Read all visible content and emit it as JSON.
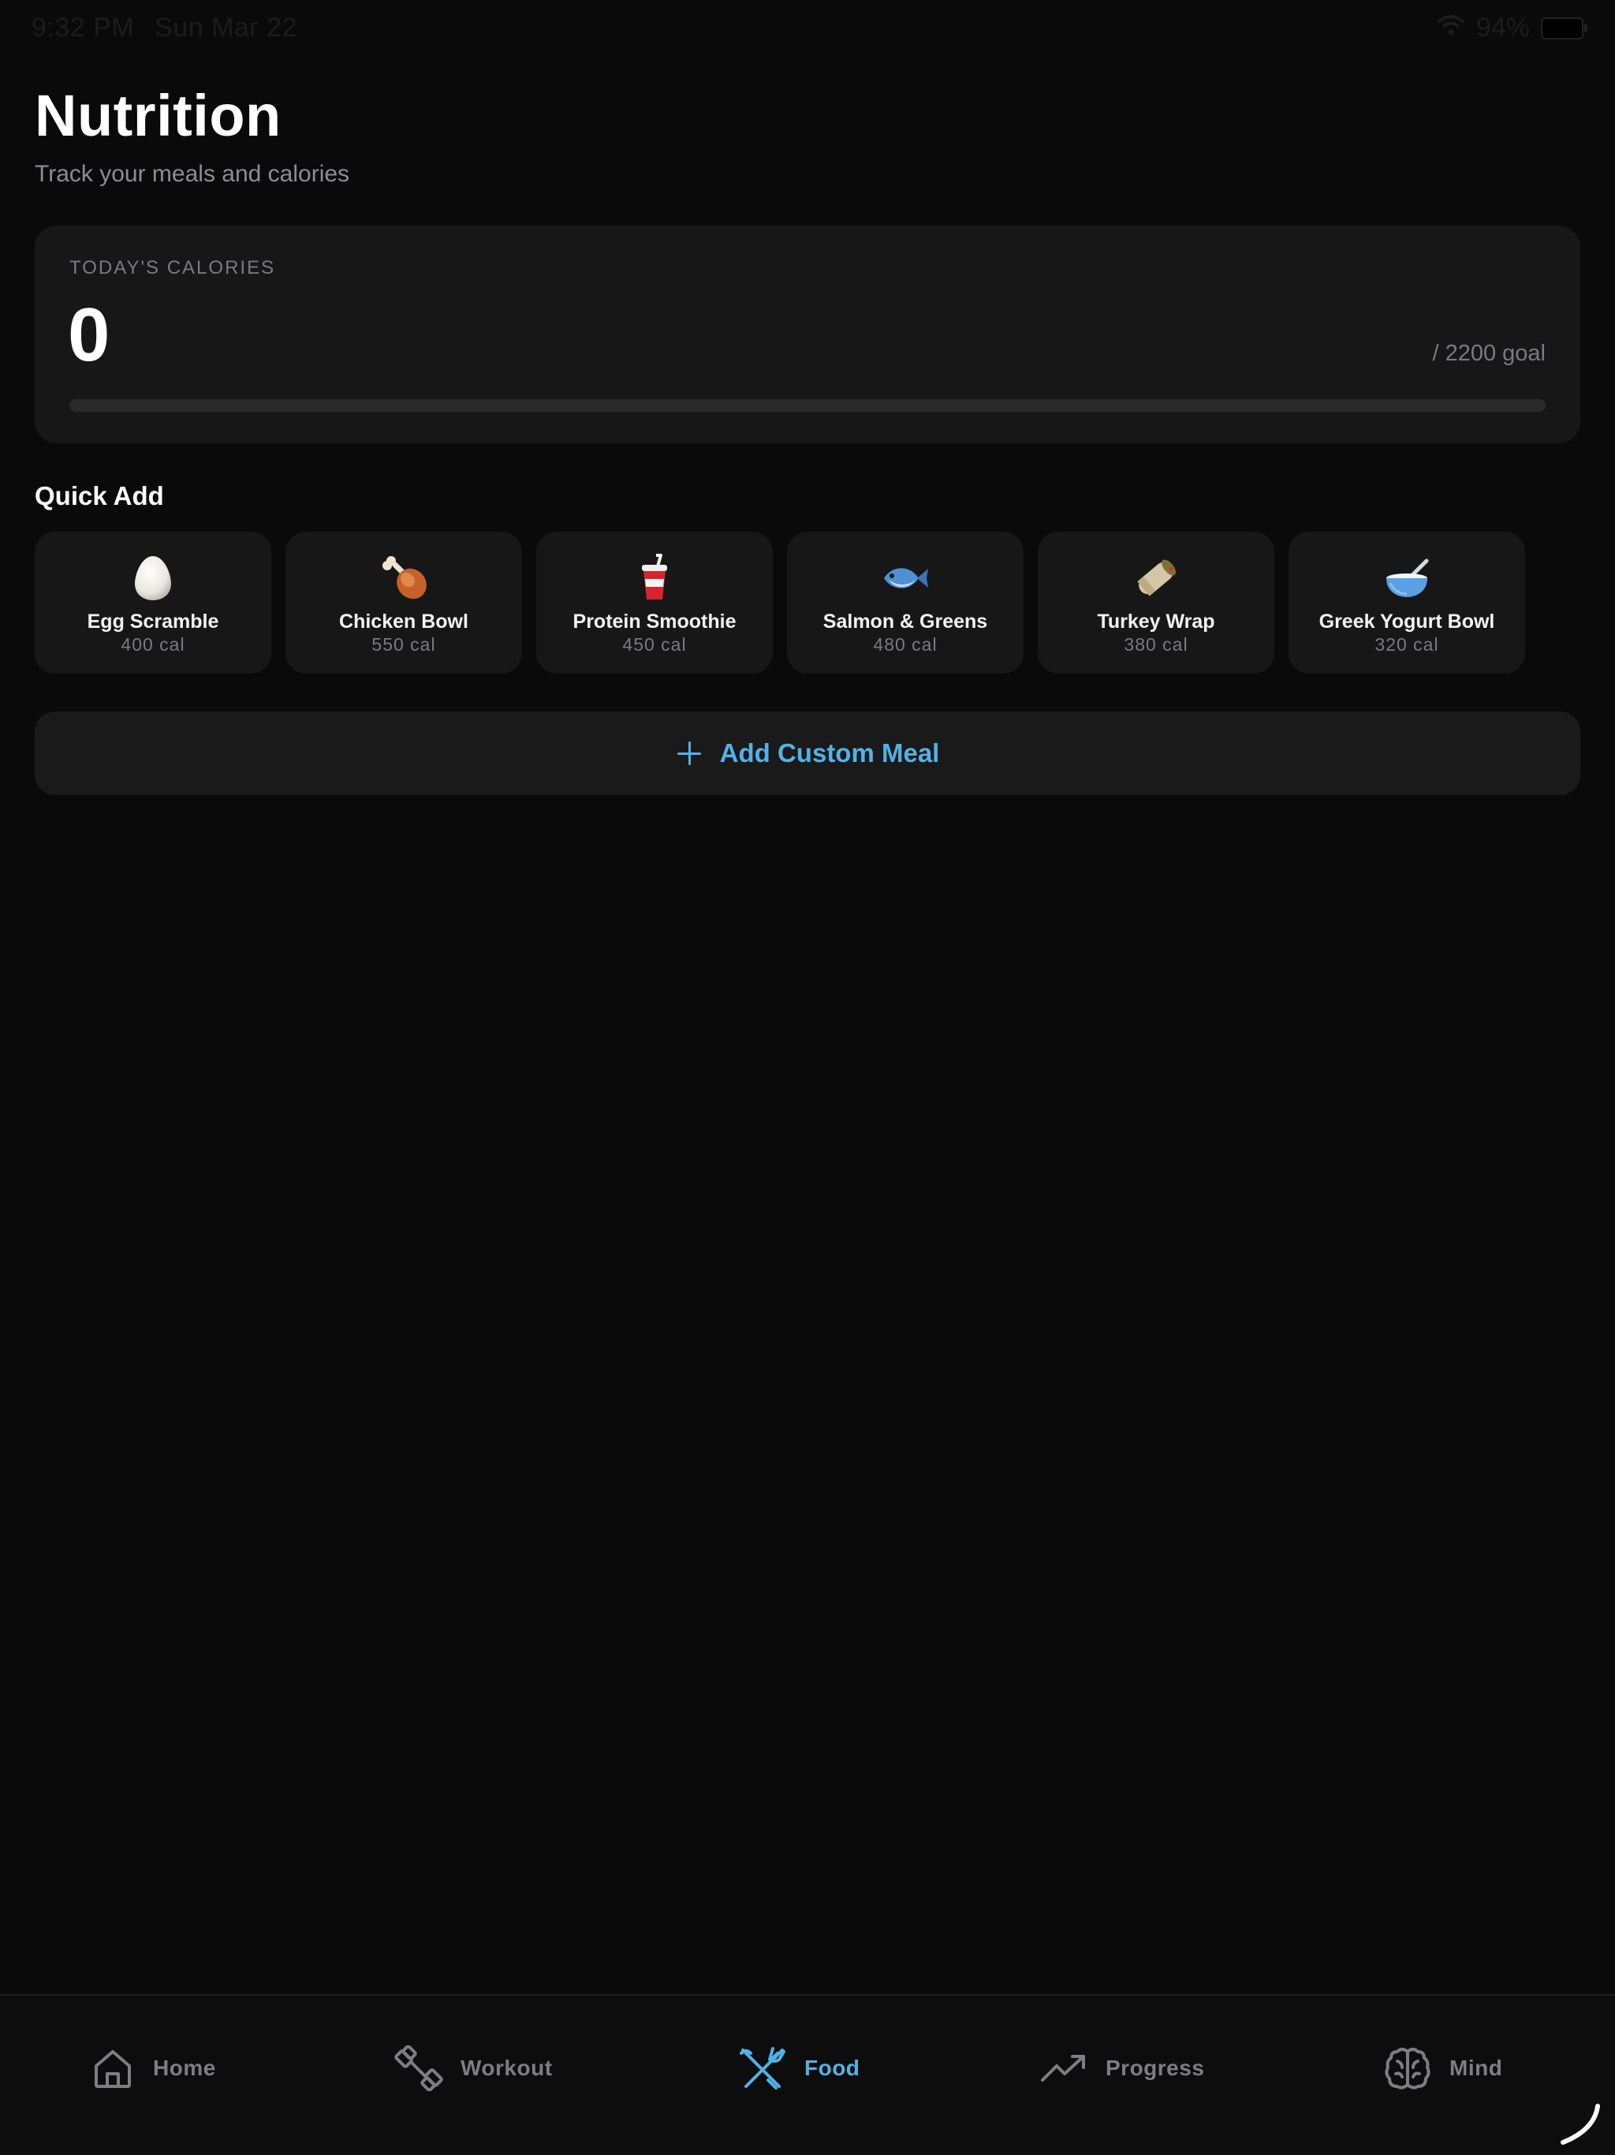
{
  "status_bar": {
    "time": "9:32 PM",
    "date": "Sun Mar 22",
    "battery": "94%",
    "wifi_icon": "wifi-icon",
    "battery_icon": "battery-icon"
  },
  "header": {
    "title": "Nutrition",
    "subtitle": "Track your meals and calories"
  },
  "calories": {
    "label": "TODAY'S CALORIES",
    "value": "0",
    "goal_text": "/ 2200 goal",
    "progress": 0
  },
  "quick_add": {
    "title": "Quick Add",
    "meals": [
      {
        "name": "Egg Scramble",
        "calories": "400 cal",
        "icon": "egg-icon"
      },
      {
        "name": "Chicken Bowl",
        "calories": "550 cal",
        "icon": "chicken-leg-icon"
      },
      {
        "name": "Protein Smoothie",
        "calories": "450 cal",
        "icon": "cup-with-straw-icon"
      },
      {
        "name": "Salmon & Greens",
        "calories": "480 cal",
        "icon": "fish-icon"
      },
      {
        "name": "Turkey Wrap",
        "calories": "380 cal",
        "icon": "burrito-icon"
      },
      {
        "name": "Greek Yogurt Bowl",
        "calories": "320 cal",
        "icon": "bowl-with-spoon-icon"
      }
    ]
  },
  "add_custom": {
    "label": "Add Custom Meal",
    "icon": "plus-icon"
  },
  "tab_bar": {
    "active": "Food",
    "accent_color": "#4fb3e8",
    "inactive_color": "#7d7d82",
    "tabs": [
      {
        "label": "Home",
        "icon": "home-icon"
      },
      {
        "label": "Workout",
        "icon": "dumbbell-icon"
      },
      {
        "label": "Food",
        "icon": "utensils-crossed-icon"
      },
      {
        "label": "Progress",
        "icon": "trending-up-icon"
      },
      {
        "label": "Mind",
        "icon": "brain-icon"
      }
    ]
  }
}
